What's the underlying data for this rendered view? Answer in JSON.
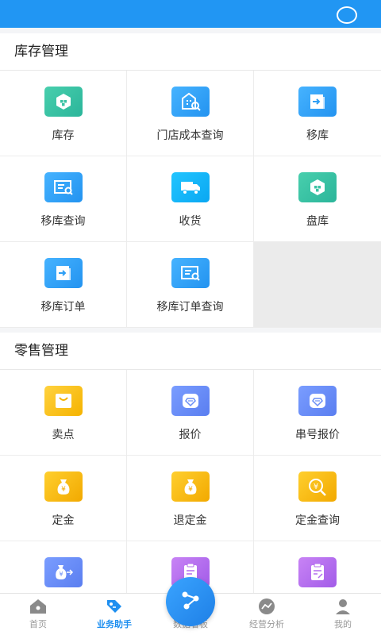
{
  "status_bar": {
    "icon": "circle-icon"
  },
  "sections": [
    {
      "title": "库存管理",
      "items": [
        {
          "label": "库存",
          "icon": "inventory-icon",
          "color": "#3cc3a4"
        },
        {
          "label": "门店成本查询",
          "icon": "store-cost-icon",
          "color": "#2f9ff5"
        },
        {
          "label": "移库",
          "icon": "transfer-icon",
          "color": "#2f9ff5"
        },
        {
          "label": "移库查询",
          "icon": "transfer-query-icon",
          "color": "#2f9ff5"
        },
        {
          "label": "收货",
          "icon": "truck-icon",
          "color": "#13b5f8"
        },
        {
          "label": "盘库",
          "icon": "stocktake-icon",
          "color": "#3cc3a4"
        },
        {
          "label": "移库订单",
          "icon": "transfer-order-icon",
          "color": "#2f9ff5"
        },
        {
          "label": "移库订单查询",
          "icon": "transfer-order-query-icon",
          "color": "#2f9ff5"
        }
      ]
    },
    {
      "title": "零售管理",
      "items": [
        {
          "label": "卖点",
          "icon": "shopping-bag-icon",
          "color": "#f7c21b"
        },
        {
          "label": "报价",
          "icon": "diamond-quote-icon",
          "color": "#6a8ef5"
        },
        {
          "label": "串号报价",
          "icon": "serial-quote-icon",
          "color": "#6a8ef5"
        },
        {
          "label": "定金",
          "icon": "money-bag-icon",
          "color": "#f4b80c"
        },
        {
          "label": "退定金",
          "icon": "refund-deposit-icon",
          "color": "#f4b80c"
        },
        {
          "label": "定金查询",
          "icon": "deposit-query-icon",
          "color": "#f4b80c"
        },
        {
          "label": "",
          "icon": "money-transfer-icon",
          "color": "#6a8ef5"
        },
        {
          "label": "",
          "icon": "clipboard-icon",
          "color": "#b36cee"
        },
        {
          "label": "",
          "icon": "clipboard-edit-icon",
          "color": "#b36cee"
        }
      ]
    }
  ],
  "tabbar": {
    "tabs": [
      {
        "label": "首页",
        "icon": "home-icon"
      },
      {
        "label": "业务助手",
        "icon": "tag-icon",
        "active": true
      },
      {
        "label": "数据看板",
        "icon": "dashboard-icon"
      },
      {
        "label": "经营分析",
        "icon": "analysis-icon"
      },
      {
        "label": "我的",
        "icon": "user-icon"
      }
    ],
    "fab_icon": "share-node-icon"
  }
}
